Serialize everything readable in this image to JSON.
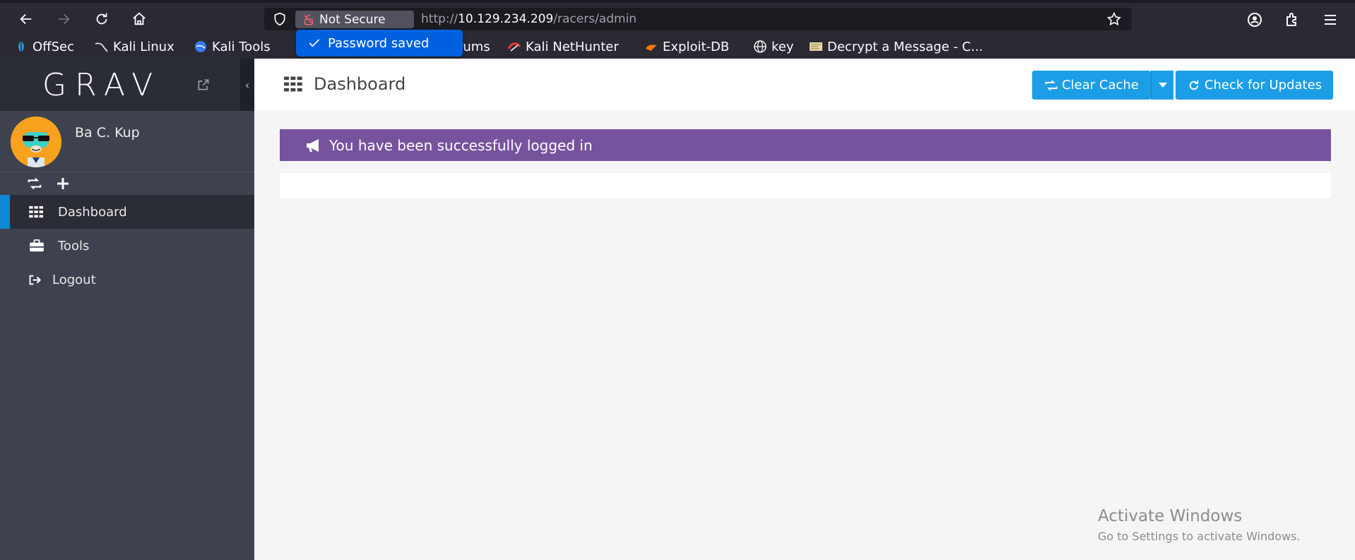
{
  "browser": {
    "security_label": "Not Secure",
    "url_prefix": "http://",
    "url_host": "10.129.234.209",
    "url_path": "/racers/admin",
    "toast": "Password saved",
    "bookmarks": [
      {
        "label": "OffSec",
        "icon": "offsec-icon"
      },
      {
        "label": "Kali Linux",
        "icon": "kali-icon"
      },
      {
        "label": "Kali Tools",
        "icon": "kali-tools-icon"
      },
      {
        "label": "rums",
        "icon": "forums-icon"
      },
      {
        "label": "Kali NetHunter",
        "icon": "nethunter-icon"
      },
      {
        "label": "Exploit-DB",
        "icon": "exploitdb-icon"
      },
      {
        "label": "key",
        "icon": "globe-icon"
      },
      {
        "label": "Decrypt a Message - C...",
        "icon": "decrypt-icon"
      }
    ]
  },
  "sidebar": {
    "logo": "GRAV",
    "collapse_glyph": "‹",
    "user_name": "Ba C. Kup",
    "items": [
      {
        "label": "Dashboard",
        "icon": "dashboard-grid-icon",
        "active": true
      },
      {
        "label": "Tools",
        "icon": "briefcase-icon",
        "active": false
      },
      {
        "label": "Logout",
        "icon": "sign-out-icon",
        "active": false
      }
    ]
  },
  "header": {
    "title": "Dashboard",
    "clear_cache": "Clear Cache",
    "check_updates": "Check for Updates"
  },
  "alert": {
    "message": "You have been successfully logged in"
  },
  "watermark": {
    "title": "Activate Windows",
    "subtitle": "Go to Settings to activate Windows."
  },
  "colors": {
    "accent": "#1c9ee6",
    "alert_bg": "#77539e",
    "sidebar_bg": "#3d424e",
    "active_marker": "#0c89d2"
  }
}
